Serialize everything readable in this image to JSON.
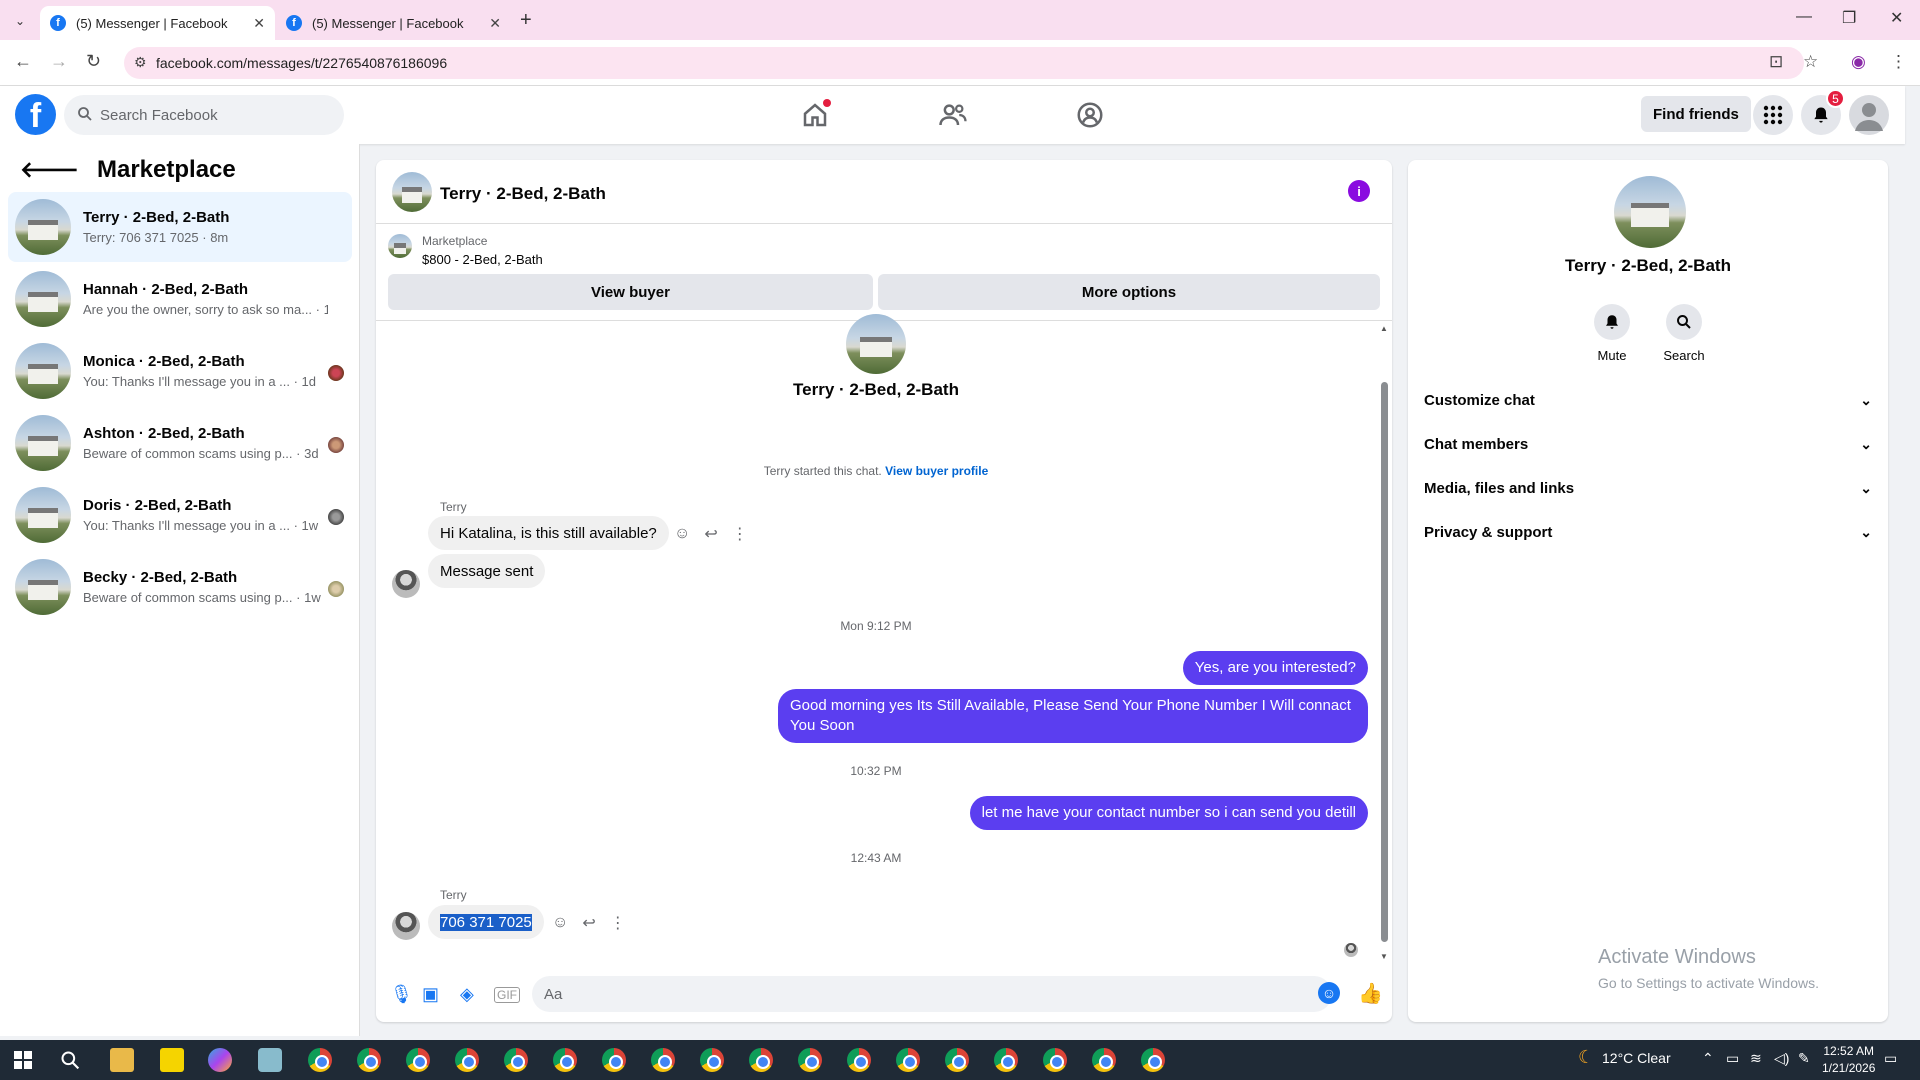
{
  "browser": {
    "tabs": [
      {
        "title": "(5) Messenger | Facebook",
        "active": true
      },
      {
        "title": "(5) Messenger | Facebook",
        "active": false
      }
    ],
    "url": "facebook.com/messages/t/2276540876186096"
  },
  "header": {
    "search_placeholder": "Search Facebook",
    "find_friends": "Find friends",
    "notification_count": "5",
    "brand_color": "#1877f2"
  },
  "sidebar": {
    "title": "Marketplace",
    "conversations": [
      {
        "name": "Terry · 2-Bed, 2-Bath",
        "preview": "Terry: 706 371 7025 · 8m",
        "active": true
      },
      {
        "name": "Hannah · 2-Bed, 2-Bath",
        "preview": "Are you the owner, sorry to ask so ma... · 1d"
      },
      {
        "name": "Monica · 2-Bed, 2-Bath",
        "preview": "You: Thanks I'll message you in a ... · 1d"
      },
      {
        "name": "Ashton · 2-Bed, 2-Bath",
        "preview": "Beware of common scams using p... · 3d"
      },
      {
        "name": "Doris · 2-Bed, 2-Bath",
        "preview": "You: Thanks I'll message you in a ... · 1w"
      },
      {
        "name": "Becky · 2-Bed, 2-Bath",
        "preview": "Beware of common scams using p... · 1w"
      }
    ]
  },
  "chat": {
    "title": "Terry · 2-Bed, 2-Bath",
    "listing_source": "Marketplace",
    "listing": "$800 - 2-Bed, 2-Bath",
    "view_buyer": "View buyer",
    "more_options": "More options",
    "profile_name": "Terry · 2-Bed, 2-Bath",
    "started_text": "Terry started this chat.",
    "view_buyer_profile": "View buyer profile",
    "sender": "Terry",
    "msg1": "Hi Katalina, is this still available?",
    "msg2": "Message sent",
    "time1": "Mon 9:12 PM",
    "out1": "Yes, are you interested?",
    "out2": "Good morning yes  Its Still Available, Please Send Your Phone Number I Will connact You Soon",
    "time2": "10:32 PM",
    "out3": "let me have your contact number so i can send you detill",
    "time3": "12:43 AM",
    "sender2": "Terry",
    "msg3": "706 371 7025",
    "compose_placeholder": "Aa",
    "outgoing_color": "#5b3ef0"
  },
  "details": {
    "name": "Terry · 2-Bed, 2-Bath",
    "mute": "Mute",
    "search": "Search",
    "sections": [
      "Customize chat",
      "Chat members",
      "Media, files and links",
      "Privacy & support"
    ]
  },
  "watermark": {
    "line1": "Activate Windows",
    "line2": "Go to Settings to activate Windows."
  },
  "taskbar": {
    "weather": "12°C  Clear",
    "time": "12:52 AM",
    "date": "1/21/2026"
  }
}
